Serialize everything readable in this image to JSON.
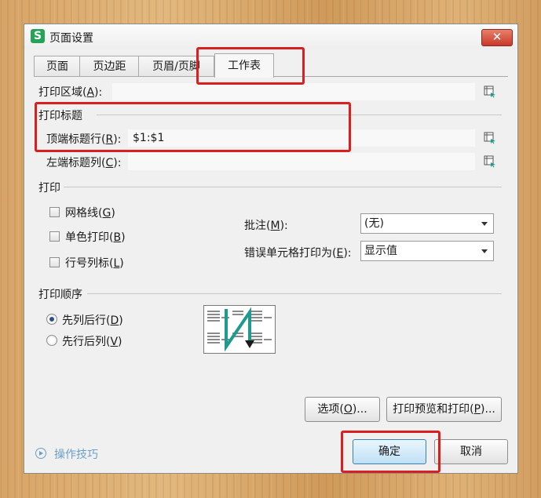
{
  "dialog": {
    "title": "页面设置",
    "app_icon_letter": "S",
    "close_glyph": "✕"
  },
  "tabs": [
    {
      "label": "页面",
      "active": false
    },
    {
      "label": "页边距",
      "active": false
    },
    {
      "label": "页眉/页脚",
      "active": false
    },
    {
      "label": "工作表",
      "active": true
    }
  ],
  "sheet": {
    "print_area": {
      "label": "打印区域(",
      "key": "A",
      "suffix": "):",
      "value": ""
    },
    "print_titles_section": "打印标题",
    "top_rows": {
      "label": "顶端标题行(",
      "key": "R",
      "suffix": "):",
      "value": "$1:$1"
    },
    "left_cols": {
      "label": "左端标题列(",
      "key": "C",
      "suffix": "):",
      "value": ""
    },
    "print_section": "打印",
    "gridlines": {
      "label": "网格线(",
      "key": "G",
      "suffix": ")",
      "checked": false
    },
    "monochrome": {
      "label": "单色打印(",
      "key": "B",
      "suffix": ")",
      "checked": false
    },
    "row_col_headings": {
      "label": "行号列标(",
      "key": "L",
      "suffix": ")",
      "checked": false
    },
    "comments": {
      "label": "批注(",
      "key": "M",
      "suffix": "):",
      "value": "(无)"
    },
    "cell_errors": {
      "label": "错误单元格打印为(",
      "key": "E",
      "suffix": "):",
      "value": "显示值"
    },
    "order_section": "打印顺序",
    "down_then_over": {
      "label": "先列后行(",
      "key": "D",
      "suffix": ")",
      "checked": true
    },
    "over_then_down": {
      "label": "先行后列(",
      "key": "V",
      "suffix": ")",
      "checked": false
    }
  },
  "buttons": {
    "options": {
      "label": "选项(",
      "key": "O",
      "suffix": ")..."
    },
    "print_preview": {
      "label": "打印预览和打印(",
      "key": "P",
      "suffix": ")..."
    },
    "ok": "确定",
    "cancel": "取消"
  },
  "tips": "操作技巧",
  "colors": {
    "highlight": "#d91f1f",
    "accent_teal": "#1f9a8e",
    "link": "#6aa0c8"
  }
}
